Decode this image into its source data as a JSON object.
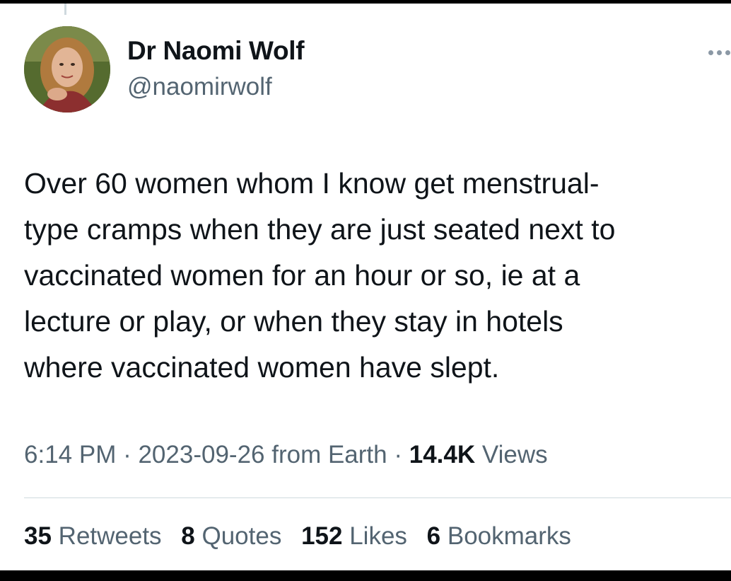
{
  "tweet": {
    "author": {
      "display_name": "Dr Naomi Wolf",
      "handle": "@naomirwolf",
      "avatar_icon": "profile-photo"
    },
    "text_lines": [
      "Over 60 women whom I know get menstrual-",
      "type cramps when they are just seated next to",
      "vaccinated women for an hour or so, ie at a",
      "lecture or play, or when they stay in hotels",
      "where vaccinated women have slept."
    ],
    "meta": {
      "time": "6:14 PM",
      "sep1": " · ",
      "date": "2023-09-26",
      "source": " from Earth",
      "sep2": " · ",
      "views_count": "14.4K",
      "views_label": " Views"
    },
    "stats": {
      "retweets_count": "35",
      "retweets_label": " Retweets",
      "quotes_count": "8",
      "quotes_label": " Quotes",
      "likes_count": "152",
      "likes_label": " Likes",
      "bookmarks_count": "6",
      "bookmarks_label": " Bookmarks"
    },
    "more_icon": "more-horizontal-icon"
  },
  "colors": {
    "text_primary": "#0f1419",
    "text_secondary": "#536471",
    "divider": "#cfd9de",
    "outer_frame": "#000000"
  }
}
